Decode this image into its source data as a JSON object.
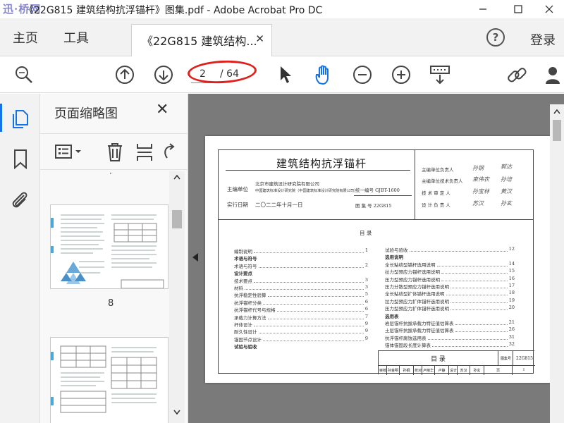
{
  "window": {
    "title": "《22G815 建筑结构抗浮锚杆》图集.pdf - Adobe Acrobat Pro DC",
    "watermark": "迅·桥网"
  },
  "menubar": {
    "home": "主页",
    "tools": "工具",
    "tab_label": "《22G815 建筑结构...",
    "help": "?",
    "login": "登录"
  },
  "toolbar": {
    "current_page": "2",
    "page_total": "/ 64"
  },
  "panel": {
    "title": "页面缩略图",
    "dot": "·",
    "thumb1_num": "8"
  },
  "document": {
    "title": "建筑结构抗浮锚杆",
    "editor_label": "主编单位",
    "editor1": "北京市建筑设计研究院有限公司",
    "editor2": "中国建筑标准设计研究院（中国建筑标准设计研究院有限公司）",
    "date_label": "实行日期",
    "date": "二〇二二年十月一日",
    "unified_no": "统一编号 GJBT-1600",
    "atlas_no": "图 集 号  22G815",
    "roles": [
      "主编单位负责人",
      "主编单位技术负责人",
      "技 术 审 定 人",
      "设 计 负 责 人"
    ],
    "signatures": [
      [
        "孙钢",
        "郭达"
      ],
      [
        "束伟农",
        "孙培"
      ],
      [
        "孙宝林",
        "黄汉"
      ],
      [
        "苏汉",
        "孙玄"
      ]
    ],
    "toc_heading": "目    录",
    "toc_left": [
      {
        "t": "编制说明",
        "p": "1"
      },
      {
        "t": "术语与符号",
        "p": ""
      },
      {
        "t": "术语与符号",
        "p": "2"
      },
      {
        "t": "设计要点",
        "p": ""
      },
      {
        "t": "技术要点",
        "p": "3"
      },
      {
        "t": "材料",
        "p": "3"
      },
      {
        "t": "抗浮稳定性验算",
        "p": "5"
      },
      {
        "t": "抗浮锚杆分类",
        "p": "6"
      },
      {
        "t": "抗浮锚杆代号与规格",
        "p": "6"
      },
      {
        "t": "承载力计算方法",
        "p": "7"
      },
      {
        "t": "杆体设计",
        "p": "9"
      },
      {
        "t": "耐久性设计",
        "p": "9"
      },
      {
        "t": "锚固节点设计",
        "p": "9"
      },
      {
        "t": "试验与验收",
        "p": ""
      }
    ],
    "toc_right": [
      {
        "t": "试验与验收",
        "p": "12"
      },
      {
        "t": "选用说明",
        "p": ""
      },
      {
        "t": "全长粘结型锚杆选用说明",
        "p": "14"
      },
      {
        "t": "拉力型预应力锚杆选用说明",
        "p": "15"
      },
      {
        "t": "压力型预应力锚杆选用说明",
        "p": "16"
      },
      {
        "t": "压力分散型预应力锚杆选用说明",
        "p": "17"
      },
      {
        "t": "全长粘结型扩体锚杆选用说明",
        "p": "18"
      },
      {
        "t": "拉力型预应力扩体锚杆选用说明",
        "p": "19"
      },
      {
        "t": "压力型预应力扩体锚杆选用说明",
        "p": "20"
      },
      {
        "t": "选用表",
        "p": ""
      },
      {
        "t": "岩层锚杆抗拔承载力特征值估算表",
        "p": "21"
      },
      {
        "t": "土层锚杆抗拔承载力特征值估算表",
        "p": "26"
      },
      {
        "t": "抗浮锚杆腐蚀选用表",
        "p": "31"
      },
      {
        "t": "锚体锚固段长度计算表",
        "p": "32"
      }
    ],
    "tb_title": "目  录",
    "tb_atlas_label": "图集号",
    "tb_atlas_no": "22G815",
    "tb_row": [
      "审核",
      "孙金明",
      "孙钢",
      "校对",
      "卢丽华",
      "卢静",
      "设计",
      "苏汉",
      "孙玄",
      "页",
      "I"
    ]
  }
}
